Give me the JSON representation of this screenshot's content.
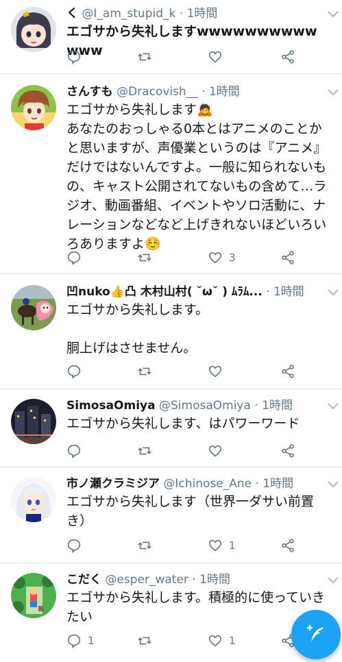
{
  "colors": {
    "accent": "#1da1f2",
    "secondary_text": "#657786",
    "divider": "#e1e8ed"
  },
  "tweets": [
    {
      "name": "く",
      "handle": "@I_am_stupid_k",
      "dot": "·",
      "time": "1時間",
      "text": "エゴサから失礼しますwwwwwwwwwwwww",
      "reply_count": "",
      "retweet_count": "",
      "like_count": "",
      "avatar_icon": "anime-girl-avatar"
    },
    {
      "name": "さんすも",
      "handle": "@Dracovish__",
      "dot": "·",
      "time": "1時間",
      "text": "エゴサから失礼します🙇\nあなたのおっしゃる0本とはアニメのことかと思いますが、声優業というのは『アニメ』だけではないんですよ。一般に知られないもの、キャスト公開されてないもの含めて…ラジオ、動画番組、イベントやソロ活動に、ナレーションなどなど上げきれないほどいろいろありますよ☺️",
      "reply_count": "",
      "retweet_count": "",
      "like_count": "3",
      "avatar_icon": "anime-boy-avatar"
    },
    {
      "name": "凹nuko👍凸 木村山村( ˘ω˘ ) ﾑﾗﾑ...",
      "handle": "",
      "dot": "·",
      "time": "1時間",
      "text": "エゴサから失礼します。\n\n胴上げはさせません。",
      "reply_count": "",
      "retweet_count": "",
      "like_count": "",
      "avatar_icon": "horse-race-avatar"
    },
    {
      "name": "SimosaOmiya",
      "handle": "@SimosaOmiya",
      "dot": "·",
      "time": "1時間",
      "text": "エゴサから失礼します、はパワーワード",
      "reply_count": "",
      "retweet_count": "",
      "like_count": "",
      "avatar_icon": "city-night-avatar"
    },
    {
      "name": "市ノ瀬クラミジア",
      "handle": "@Ichinose_Ane",
      "dot": "·",
      "time": "1時間",
      "text": "エゴサから失礼します（世界一ダサい前置き）",
      "reply_count": "",
      "retweet_count": "",
      "like_count": "1",
      "avatar_icon": "white-hair-girl-avatar"
    },
    {
      "name": "こだく",
      "handle": "@esper_water",
      "dot": "·",
      "time": "1時間",
      "text": "エゴサから失礼します。積極的に使っていきたい",
      "reply_count": "1",
      "retweet_count": "",
      "like_count": "1",
      "avatar_icon": "game-scene-avatar"
    }
  ],
  "fab": {
    "icon": "compose-feather-icon"
  }
}
